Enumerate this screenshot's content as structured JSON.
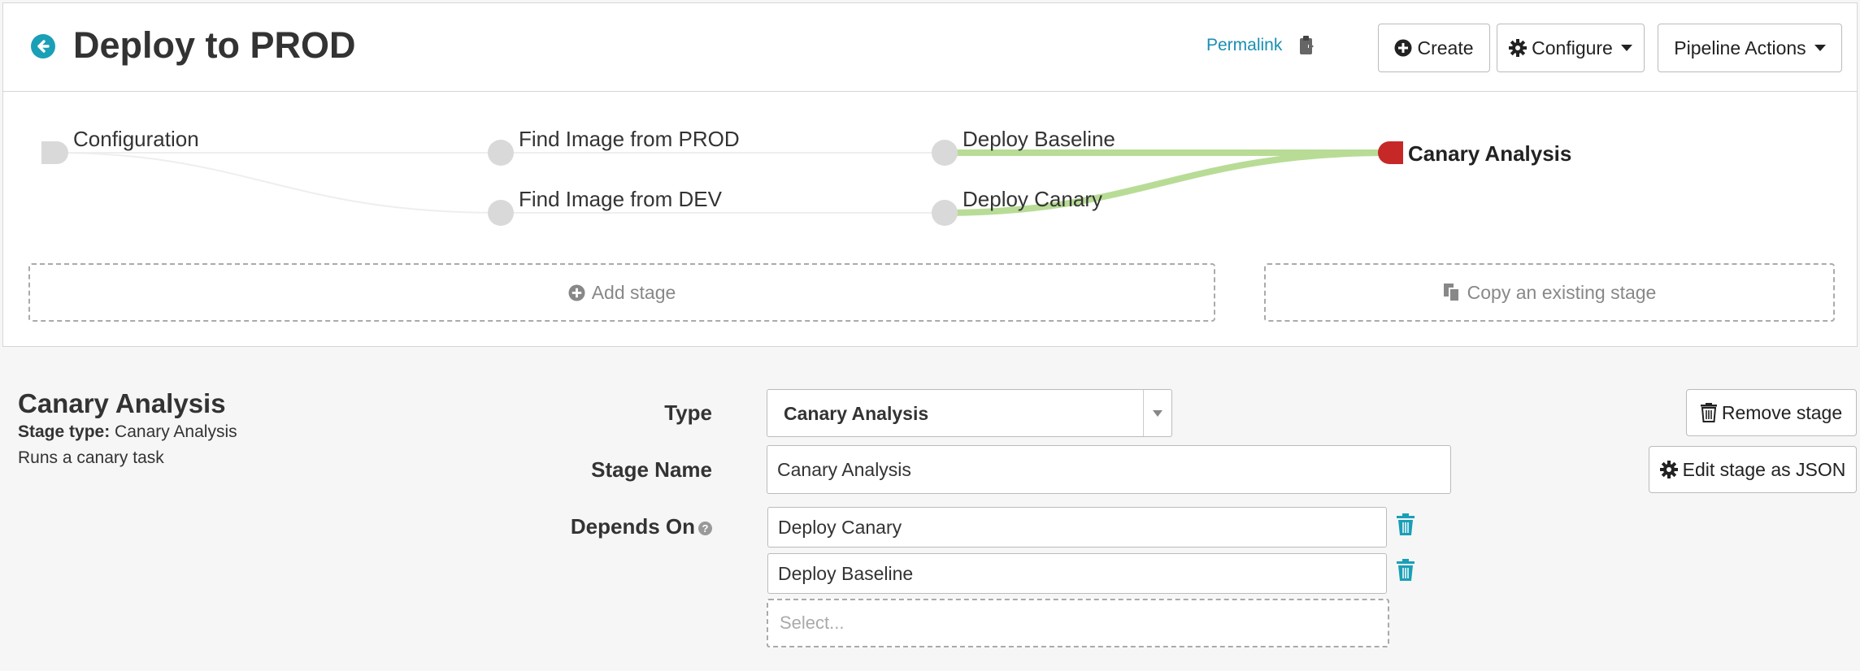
{
  "header": {
    "title": "Deploy to PROD",
    "permalink": "Permalink",
    "create_label": "Create",
    "configure_label": "Configure",
    "pipeline_actions_label": "Pipeline Actions",
    "accent_color": "#1a9fb7"
  },
  "graph": {
    "nodes": [
      {
        "label": "Configuration"
      },
      {
        "label": "Find Image from PROD"
      },
      {
        "label": "Find Image from DEV"
      },
      {
        "label": "Deploy Baseline"
      },
      {
        "label": "Deploy Canary"
      },
      {
        "label": "Canary Analysis"
      }
    ],
    "active_color": "#c62828",
    "edge_highlight_color": "#b8dc96"
  },
  "actions": {
    "add_stage": "Add stage",
    "copy_stage": "Copy an existing stage"
  },
  "stage": {
    "title": "Canary Analysis",
    "type_label": "Stage type:",
    "type_value": "Canary Analysis",
    "description": "Runs a canary task",
    "remove_label": "Remove stage",
    "edit_json_label": "Edit stage as JSON"
  },
  "form": {
    "type_label": "Type",
    "type_value": "Canary Analysis",
    "stage_name_label": "Stage Name",
    "stage_name_value": "Canary Analysis",
    "depends_on_label": "Depends On",
    "depends_on": [
      "Deploy Canary",
      "Deploy Baseline"
    ],
    "select_placeholder": "Select..."
  }
}
